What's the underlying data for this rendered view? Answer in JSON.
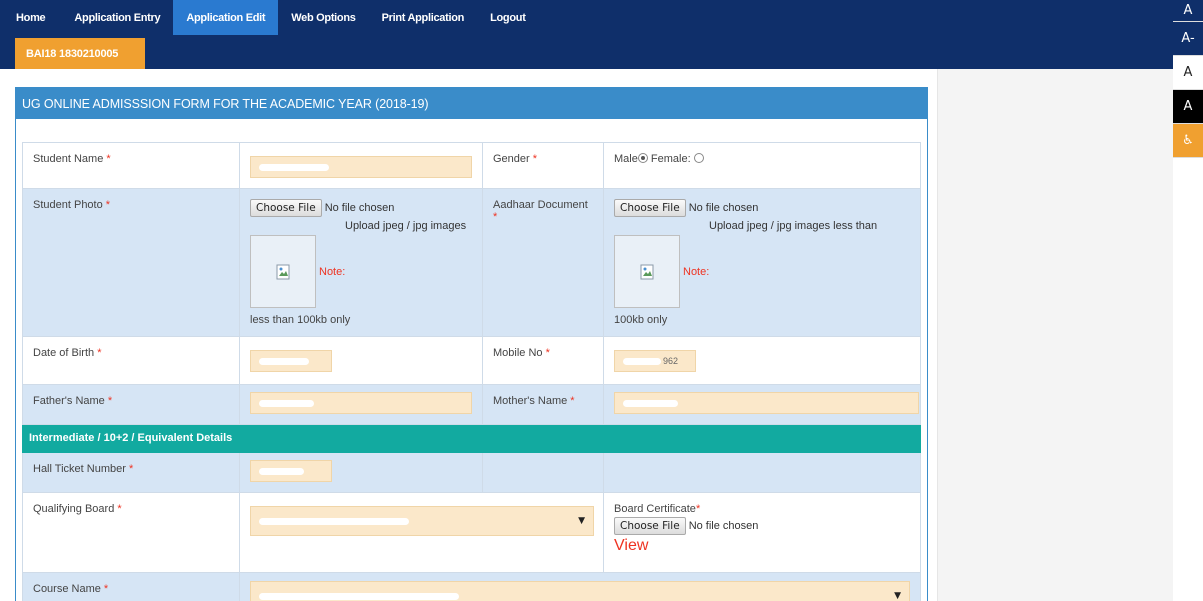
{
  "nav": {
    "items": [
      "Home",
      "Application Entry",
      "Application Edit",
      "Web Options",
      "Print Application",
      "Logout"
    ],
    "active_index": 2,
    "user_tab": "BAI18 1830210005"
  },
  "a11y": [
    "A",
    "A-",
    "A",
    "A",
    "wheelchair-icon"
  ],
  "form": {
    "title": "UG ONLINE ADMISSSION FORM FOR THE ACADEMIC YEAR (2018-19)",
    "required_mark": "*",
    "student_name": {
      "label": "Student Name",
      "value": ""
    },
    "gender": {
      "label": "Gender",
      "options": [
        "Male",
        "Female:"
      ],
      "selected": "Male"
    },
    "student_photo": {
      "label": "Student Photo",
      "button": "Choose File",
      "status": "No file chosen",
      "hint": "Upload jpeg / jpg images",
      "note": "Note:",
      "hint_tail": "less than 100kb only"
    },
    "aadhaar": {
      "label": "Aadhaar Document",
      "button": "Choose File",
      "status": "No file chosen",
      "hint": "Upload jpeg / jpg images less than",
      "note": "Note:",
      "hint_tail": "100kb only"
    },
    "dob": {
      "label": "Date of Birth"
    },
    "mobile": {
      "label": "Mobile No",
      "suffix": "962"
    },
    "father": {
      "label": "Father's Name"
    },
    "mother": {
      "label": "Mother's Name"
    },
    "section_title": "Intermediate / 10+2 / Equivalent Details",
    "hall_ticket": {
      "label": "Hall Ticket Number"
    },
    "qualifying_board": {
      "label": "Qualifying Board"
    },
    "board_cert": {
      "label": "Board Certificate",
      "button": "Choose File",
      "status": "No file chosen",
      "view": "View"
    },
    "course": {
      "label": "Course Name"
    }
  },
  "colors": {
    "header": "#0f2f6a",
    "active_tab": "#2a7ad0",
    "user_tab": "#f0a030",
    "panel_head": "#3a8cc9",
    "section": "#12aaa0",
    "input_bg": "#fbe8ca"
  }
}
